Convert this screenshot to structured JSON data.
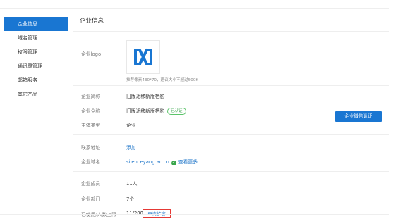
{
  "sidebar": {
    "items": [
      {
        "label": "企业信息"
      },
      {
        "label": "域名管理"
      },
      {
        "label": "权限管理"
      },
      {
        "label": "通讯录管理"
      },
      {
        "label": "邮箱服务"
      },
      {
        "label": "其它产品"
      }
    ]
  },
  "main": {
    "title": "企业信息",
    "logo": {
      "label": "企业logo",
      "hint": "推荐像素430*70，建议大小不超过500K"
    },
    "short_name": {
      "label": "企业简称",
      "value": "旧版迁移新版栖影"
    },
    "full_name": {
      "label": "企业全称",
      "value": "旧版迁移新版栖影",
      "badge": "已认证"
    },
    "subject_type": {
      "label": "主体类型",
      "value": "企业",
      "button": "企业微信认证"
    },
    "address": {
      "label": "联系地址",
      "action": "添加"
    },
    "domain": {
      "label": "企业域名",
      "value": "silenceyang.ac.cn",
      "more": "查看更多"
    },
    "members": {
      "label": "企业成员",
      "value": "11人"
    },
    "departments": {
      "label": "企业部门",
      "value": "7个"
    },
    "seats": {
      "label": "已使用/人数上限",
      "value": "11/200",
      "action": "申请扩容"
    }
  },
  "colors": {
    "accent": "#1976d2",
    "link": "#1a73c8",
    "success": "#3aa64c",
    "highlight_border": "#e53935"
  },
  "icons": {
    "logo": "company-logo-icon",
    "verified": "check-circle-icon"
  }
}
